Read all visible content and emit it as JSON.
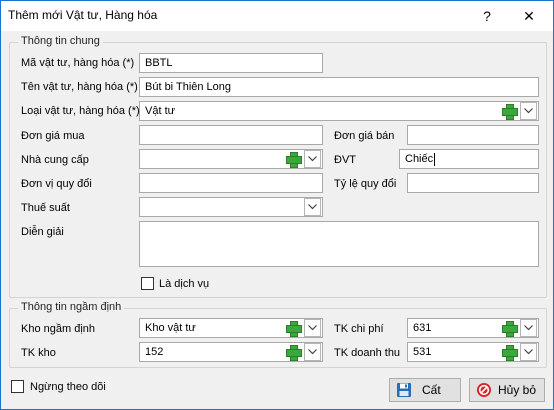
{
  "window": {
    "title": "Thêm mới Vật tư, Hàng hóa",
    "help_label": "?",
    "close_label": "✕"
  },
  "general": {
    "legend": "Thông tin chung",
    "code": {
      "label": "Mã vật tư, hàng hóa (*)",
      "value": "BBTL"
    },
    "name": {
      "label": "Tên vật tư, hàng hóa (*)",
      "value": "Bút bi Thiên Long"
    },
    "type": {
      "label": "Loại vật tư, hàng hóa (*)",
      "value": "Vật tư"
    },
    "purchase_price": {
      "label": "Đơn giá mua",
      "value": ""
    },
    "sale_price": {
      "label": "Đơn giá bán",
      "value": ""
    },
    "supplier": {
      "label": "Nhà cung cấp",
      "value": ""
    },
    "unit": {
      "label": "ĐVT",
      "value": "Chiếc"
    },
    "conversion_unit": {
      "label": "Đơn vị quy đổi",
      "value": ""
    },
    "conversion_rate": {
      "label": "Tỷ lệ quy đổi",
      "value": ""
    },
    "tax_rate": {
      "label": "Thuế suất",
      "value": ""
    },
    "description": {
      "label": "Diễn giải",
      "value": ""
    },
    "is_service": {
      "label": "Là dịch vụ",
      "checked": false
    }
  },
  "defaults": {
    "legend": "Thông tin ngầm định",
    "warehouse": {
      "label": "Kho ngầm định",
      "value": "Kho vật tư"
    },
    "expense_account": {
      "label": "TK chi phí",
      "value": "631"
    },
    "warehouse_account": {
      "label": "TK kho",
      "value": "152"
    },
    "revenue_account": {
      "label": "TK doanh thu",
      "value": "531"
    }
  },
  "footer": {
    "stop_tracking": {
      "label": "Ngừng theo dõi",
      "checked": false
    },
    "save_label": "Cất",
    "cancel_label": "Hủy bỏ"
  },
  "colors": {
    "title_border": "#1874cc",
    "add_icon": "#3aa83a",
    "cancel_icon": "#d7262e",
    "save_icon": "#2b6cb8"
  },
  "icons": {
    "add": "plus-icon",
    "dropdown": "chevron-down-icon",
    "save": "floppy-disk-icon",
    "cancel": "cancel-icon"
  }
}
